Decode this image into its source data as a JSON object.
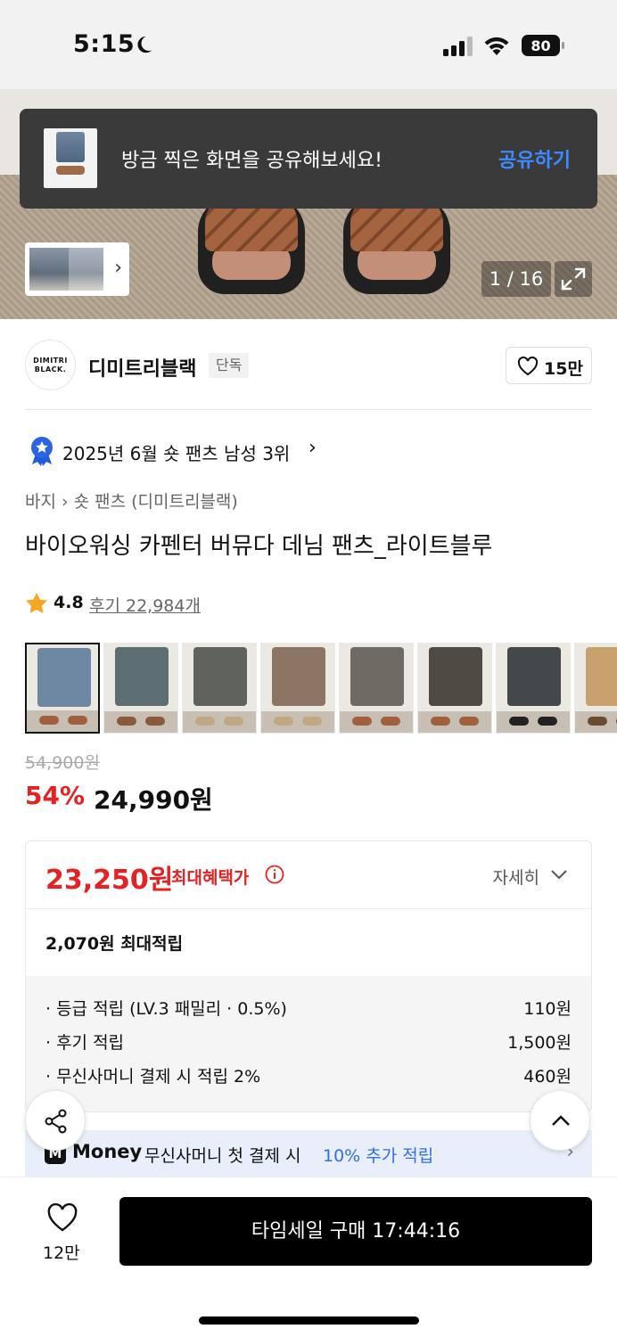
{
  "status_bar": {
    "time": "5:15",
    "battery": "80"
  },
  "toast": {
    "message": "방금 찍은 화면을 공유해보세요!",
    "action": "공유하기"
  },
  "gallery": {
    "page_indicator": "1 / 16"
  },
  "brand": {
    "logo_text": "DIMITRI BLACK.",
    "name": "디미트리블랙",
    "tag": "단독",
    "likes": "15만"
  },
  "ranking": {
    "text": "2025년 6월 숏 팬츠 남성 3위"
  },
  "breadcrumb": {
    "category": "바지",
    "subcategory": "숏 팬츠 (디미트리블랙)"
  },
  "product": {
    "title": "바이오워싱 카펜터 버뮤다 데님 팬츠_라이트블루",
    "rating": "4.8",
    "reviews": "후기 22,984개",
    "original_price": "54,900원",
    "discount": "54%",
    "sale_price": "24,990원"
  },
  "color_options": [
    {
      "name": "light-blue",
      "color": "#6e87a3",
      "selected": true
    },
    {
      "name": "blue-washed",
      "color": "#5d6e73"
    },
    {
      "name": "camo",
      "color": "#5f635c"
    },
    {
      "name": "brown",
      "color": "#8c7563"
    },
    {
      "name": "grey-washed",
      "color": "#6f6a63"
    },
    {
      "name": "dark-washed",
      "color": "#4f4a44"
    },
    {
      "name": "charcoal",
      "color": "#45484a"
    },
    {
      "name": "beige",
      "color": "#c9a16e"
    }
  ],
  "benefit": {
    "max_benefit_price": "23,250원",
    "max_benefit_label": "최대혜택가",
    "detail_label": "자세히",
    "max_accumulation": "2,070원 최대적립",
    "rows": [
      {
        "label": "· 등급 적립 (LV.3 패밀리 · 0.5%)",
        "value": "110원"
      },
      {
        "label": "· 후기 적립",
        "value": "1,500원"
      },
      {
        "label": "· 무신사머니 결제 시 적립 2%",
        "value": "460원"
      }
    ]
  },
  "money_banner": {
    "logo": "M",
    "brand": "Money",
    "text": "무신사머니 첫 결제 시",
    "highlight": "10% 추가 적립"
  },
  "bottom_bar": {
    "wish_count": "12만",
    "buy_label": "타임세일 구매 17:44:16"
  },
  "colors": {
    "accent_red": "#e52222",
    "link_blue": "#3d8bff",
    "money_blue": "#2f6fe8"
  }
}
